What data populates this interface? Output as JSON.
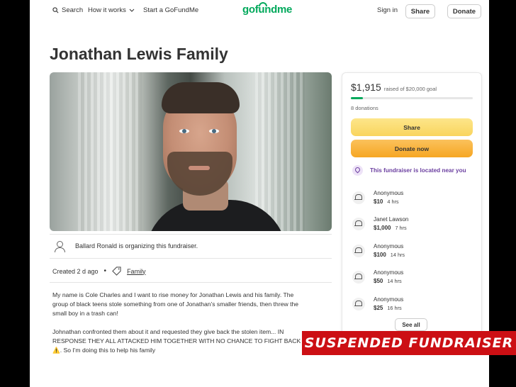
{
  "nav": {
    "search_label": "Search",
    "how_it_works_label": "How it works",
    "start_label": "Start a GoFundMe",
    "logo_text": "gofundme",
    "signin_label": "Sign in",
    "share_label": "Share",
    "donate_label": "Donate"
  },
  "campaign": {
    "title": "Jonathan Lewis Family",
    "organizer_text": "Ballard Ronald is organizing this fundraiser.",
    "created_text": "Created 2 d ago",
    "category": "Family",
    "story": [
      "My name is Cole Charles and I want to rise money for Jonathan Lewis and his family. The group of black teens stole something from one of Jonathan's smaller friends, then threw the small boy in a trash can!",
      "Johnathan confronted them about it and requested they give back the stolen item... IN RESPONSE THEY ALL ATTACKED HIM TOGETHER WITH NO CHANCE TO FIGHT BACK ⚠️. So I'm doing this to help his family"
    ]
  },
  "sidebar": {
    "raised_amount": "$1,915",
    "goal_text": "raised of $20,000 goal",
    "progress_fraction": 0.096,
    "donations_count": "8 donations",
    "share_button": "Share",
    "donate_button": "Donate now",
    "near_you_text": "This fundraiser is located near you",
    "see_all_label": "See all",
    "donors": [
      {
        "name": "Anonymous",
        "amount": "$10",
        "time": "4 hrs"
      },
      {
        "name": "Janet Lawson",
        "amount": "$1,000",
        "time": "7 hrs"
      },
      {
        "name": "Anonymous",
        "amount": "$100",
        "time": "14 hrs"
      },
      {
        "name": "Anonymous",
        "amount": "$50",
        "time": "14 hrs"
      },
      {
        "name": "Anonymous",
        "amount": "$25",
        "time": "16 hrs"
      }
    ]
  },
  "overlay": {
    "banner_text": "SUSPENDED FUNDRAISER"
  },
  "colors": {
    "brand_green": "#02a95c",
    "share_yellow": "#f9d45e",
    "donate_orange": "#f6a623",
    "near_purple": "#6b3fa0",
    "banner_red": "#cc0f14"
  }
}
